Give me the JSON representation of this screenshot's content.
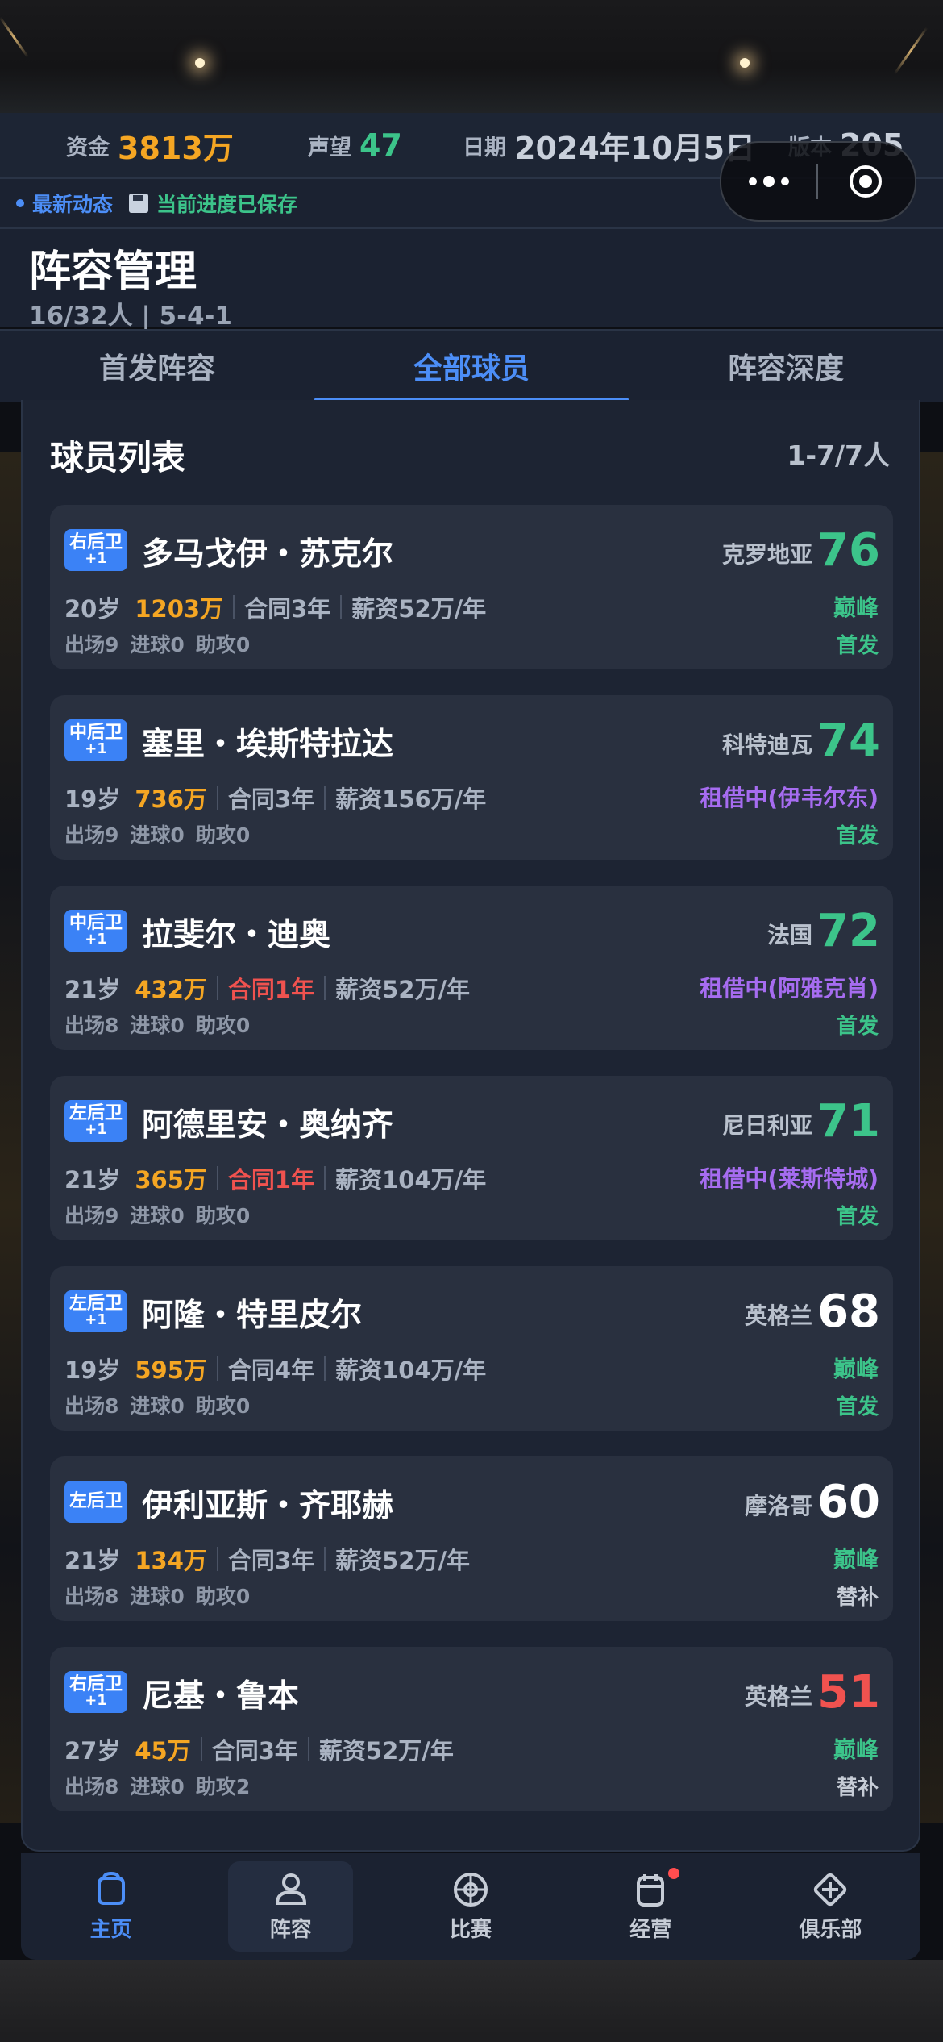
{
  "topbar": {
    "funds_label": "资金",
    "funds_value": "3813万",
    "fame_label": "声望",
    "fame_value": "47",
    "date_label": "日期",
    "date_value": "2024年10月5日",
    "version_label": "版本",
    "version_value": "205"
  },
  "newsbar": {
    "news_label": "最新动态",
    "save_label": "当前进度已保存"
  },
  "header": {
    "title": "阵容管理",
    "subinfo": "16/32人 | 5-4-1"
  },
  "tabs": [
    {
      "label": "首发阵容",
      "active": false
    },
    {
      "label": "全部球员",
      "active": true
    },
    {
      "label": "阵容深度",
      "active": false
    }
  ],
  "list": {
    "title": "球员列表",
    "count": "1-7/7人",
    "players": [
      {
        "pos": "右后卫",
        "plus": "+1",
        "name": "多马戈伊・苏克尔",
        "nation": "克罗地亚",
        "rating": "76",
        "rating_color": "#3cc48a",
        "age": "20岁",
        "value": "1203万",
        "contract": "合同3年",
        "contract_color": "#aab3c2",
        "salary": "薪资52万/年",
        "status": "巅峰",
        "status_color": "#3cc48a",
        "apps": "出场9",
        "goals": "进球0",
        "assists": "助攻0",
        "role": "首发",
        "role_color": "#3cc48a"
      },
      {
        "pos": "中后卫",
        "plus": "+1",
        "name": "塞里・埃斯特拉达",
        "nation": "科特迪瓦",
        "rating": "74",
        "rating_color": "#3cc48a",
        "age": "19岁",
        "value": "736万",
        "contract": "合同3年",
        "contract_color": "#aab3c2",
        "salary": "薪资156万/年",
        "status": "租借中(伊韦尔东)",
        "status_color": "#a66cf0",
        "apps": "出场9",
        "goals": "进球0",
        "assists": "助攻0",
        "role": "首发",
        "role_color": "#3cc48a"
      },
      {
        "pos": "中后卫",
        "plus": "+1",
        "name": "拉斐尔・迪奥",
        "nation": "法国",
        "rating": "72",
        "rating_color": "#3cc48a",
        "age": "21岁",
        "value": "432万",
        "contract": "合同1年",
        "contract_color": "#f0524f",
        "salary": "薪资52万/年",
        "status": "租借中(阿雅克肖)",
        "status_color": "#a66cf0",
        "apps": "出场8",
        "goals": "进球0",
        "assists": "助攻0",
        "role": "首发",
        "role_color": "#3cc48a"
      },
      {
        "pos": "左后卫",
        "plus": "+1",
        "name": "阿德里安・奥纳齐",
        "nation": "尼日利亚",
        "rating": "71",
        "rating_color": "#3cc48a",
        "age": "21岁",
        "value": "365万",
        "contract": "合同1年",
        "contract_color": "#f0524f",
        "salary": "薪资104万/年",
        "status": "租借中(莱斯特城)",
        "status_color": "#a66cf0",
        "apps": "出场9",
        "goals": "进球0",
        "assists": "助攻0",
        "role": "首发",
        "role_color": "#3cc48a"
      },
      {
        "pos": "左后卫",
        "plus": "+1",
        "name": "阿隆・特里皮尔",
        "nation": "英格兰",
        "rating": "68",
        "rating_color": "#ffffff",
        "age": "19岁",
        "value": "595万",
        "contract": "合同4年",
        "contract_color": "#aab3c2",
        "salary": "薪资104万/年",
        "status": "巅峰",
        "status_color": "#3cc48a",
        "apps": "出场8",
        "goals": "进球0",
        "assists": "助攻0",
        "role": "首发",
        "role_color": "#3cc48a"
      },
      {
        "pos": "左后卫",
        "plus": "",
        "name": "伊利亚斯・齐耶赫",
        "nation": "摩洛哥",
        "rating": "60",
        "rating_color": "#ffffff",
        "age": "21岁",
        "value": "134万",
        "contract": "合同3年",
        "contract_color": "#aab3c2",
        "salary": "薪资52万/年",
        "status": "巅峰",
        "status_color": "#3cc48a",
        "apps": "出场8",
        "goals": "进球0",
        "assists": "助攻0",
        "role": "替补",
        "role_color": "#c6ccd6"
      },
      {
        "pos": "右后卫",
        "plus": "+1",
        "name": "尼基・鲁本",
        "nation": "英格兰",
        "rating": "51",
        "rating_color": "#f0524f",
        "age": "27岁",
        "value": "45万",
        "contract": "合同3年",
        "contract_color": "#aab3c2",
        "salary": "薪资52万/年",
        "status": "巅峰",
        "status_color": "#3cc48a",
        "apps": "出场8",
        "goals": "进球0",
        "assists": "助攻2",
        "role": "替补",
        "role_color": "#c6ccd6"
      }
    ]
  },
  "nav": [
    {
      "label": "主页",
      "icon": "home-icon"
    },
    {
      "label": "阵容",
      "icon": "squad-icon"
    },
    {
      "label": "比赛",
      "icon": "match-icon"
    },
    {
      "label": "经营",
      "icon": "business-icon"
    },
    {
      "label": "俱乐部",
      "icon": "club-icon"
    }
  ],
  "colors": {
    "accent": "#4c8ef7",
    "gold": "#f5a623",
    "green": "#3cc48a",
    "red": "#f0524f",
    "purple": "#a66cf0"
  }
}
